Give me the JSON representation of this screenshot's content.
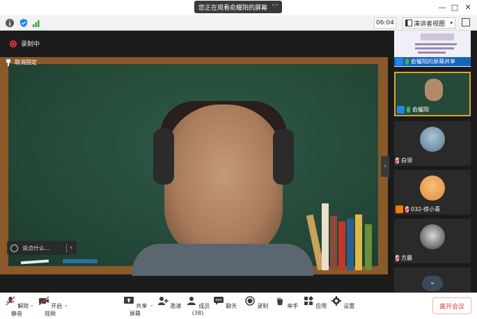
{
  "titlebar": {
    "share_text": "您正在观看俞耀阳的屏幕",
    "more": "⋯",
    "minimize": "—",
    "maximize": "□",
    "close": "✕"
  },
  "toolbar": {
    "timer": "06:04",
    "view_label": "演讲者视图",
    "view_caret": "▾"
  },
  "stage": {
    "recording": "录制中",
    "pin_label": "取消固定",
    "chat_placeholder": "说点什么...",
    "chat_chevron": "‹",
    "collapse": "›"
  },
  "sidebar": {
    "tiles": [
      {
        "name": "俞耀阳的屏幕共享",
        "user_color": "#1e88e5",
        "mic": "on"
      },
      {
        "name": "俞耀阳",
        "user_color": "#1e88e5",
        "mic": "on"
      },
      {
        "name": "白领",
        "mic": "off"
      },
      {
        "name": "032-徐小青",
        "user_color": "#f57c00",
        "mic": "off"
      },
      {
        "name": "方晨",
        "mic": "off"
      }
    ],
    "scroll_down": "⌄"
  },
  "bottombar": {
    "items": [
      {
        "label": "解除静音"
      },
      {
        "label": "开启视频"
      },
      {
        "label": "共享屏幕"
      },
      {
        "label": "邀请"
      },
      {
        "label": "成员(38)"
      },
      {
        "label": "聊天"
      },
      {
        "label": "录制"
      },
      {
        "label": "举手"
      },
      {
        "label": "应用"
      },
      {
        "label": "设置"
      }
    ],
    "leave_label": "离开会议"
  }
}
